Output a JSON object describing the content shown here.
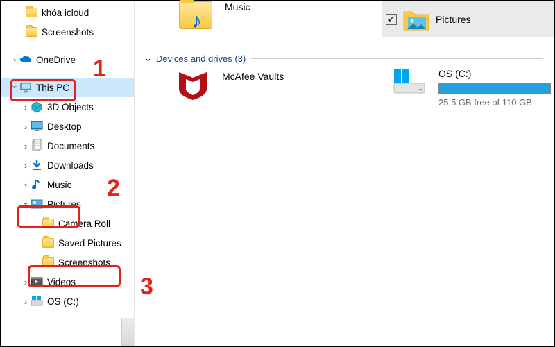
{
  "sidebar": {
    "items": [
      {
        "label": "khóa icloud",
        "indent": "indent0",
        "chev": "none",
        "icon": "folder"
      },
      {
        "label": "Screenshots",
        "indent": "indent0",
        "chev": "none",
        "icon": "folder"
      },
      {
        "label": "OneDrive",
        "indent": "indent1",
        "chev": "closed",
        "icon": "onedrive"
      },
      {
        "label": "This PC",
        "indent": "indent1",
        "chev": "open",
        "icon": "thispc",
        "selected": true
      },
      {
        "label": "3D Objects",
        "indent": "indent2",
        "chev": "closed",
        "icon": "3d"
      },
      {
        "label": "Desktop",
        "indent": "indent2",
        "chev": "closed",
        "icon": "desktop"
      },
      {
        "label": "Documents",
        "indent": "indent2",
        "chev": "closed",
        "icon": "documents"
      },
      {
        "label": "Downloads",
        "indent": "indent2",
        "chev": "closed",
        "icon": "downloads"
      },
      {
        "label": "Music",
        "indent": "indent2",
        "chev": "closed",
        "icon": "music"
      },
      {
        "label": "Pictures",
        "indent": "indent2",
        "chev": "open",
        "icon": "pictures"
      },
      {
        "label": "Camera Roll",
        "indent": "indent3",
        "chev": "none",
        "icon": "folder"
      },
      {
        "label": "Saved Pictures",
        "indent": "indent3",
        "chev": "none",
        "icon": "folder"
      },
      {
        "label": "Screenshots",
        "indent": "indent3",
        "chev": "none",
        "icon": "folder"
      },
      {
        "label": "Videos",
        "indent": "indent2",
        "chev": "closed",
        "icon": "videos"
      },
      {
        "label": "OS (C:)",
        "indent": "indent2",
        "chev": "closed",
        "icon": "drive"
      }
    ]
  },
  "annotations": {
    "n1": "1",
    "n2": "2",
    "n3": "3"
  },
  "content": {
    "music_label": "Music",
    "group_label": "Devices and drives (3)",
    "mcafee_label": "McAfee Vaults",
    "drive_name": "OS (C:)",
    "drive_free": "25.5 GB free of 110 GB"
  },
  "header": {
    "pictures_label": "Pictures"
  }
}
